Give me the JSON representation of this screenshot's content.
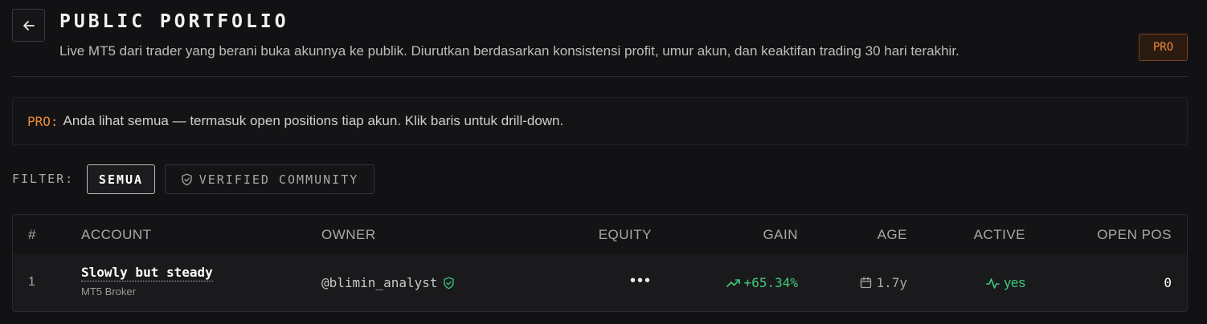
{
  "header": {
    "title": "PUBLIC PORTFOLIO",
    "subtitle": "Live MT5 dari trader yang berani buka akunnya ke publik. Diurutkan berdasarkan konsistensi profit, umur akun, dan keaktifan trading 30 hari terakhir.",
    "badge": "PRO",
    "back_icon": "arrow-left-icon"
  },
  "notice": {
    "label": "PRO:",
    "text": "Anda lihat semua — termasuk open positions tiap akun. Klik baris untuk drill-down."
  },
  "filter": {
    "label": "FILTER:",
    "options": [
      {
        "label": "SEMUA",
        "selected": true
      },
      {
        "label": "VERIFIED COMMUNITY",
        "selected": false,
        "icon": "shield-check-icon"
      }
    ]
  },
  "table": {
    "columns": [
      "#",
      "ACCOUNT",
      "OWNER",
      "EQUITY",
      "GAIN",
      "AGE",
      "ACTIVE",
      "OPEN POS"
    ],
    "rows": [
      {
        "rank": "1",
        "account_name": "Slowly but steady",
        "broker": "MT5 Broker",
        "owner": "@blimin_analyst",
        "equity": "•••",
        "gain": "+65.34%",
        "age": "1.7y",
        "active": "yes",
        "open_pos": "0"
      }
    ]
  },
  "colors": {
    "background": "#121214",
    "accent_orange": "#ef8a3a",
    "positive_green": "#3ec97a"
  }
}
